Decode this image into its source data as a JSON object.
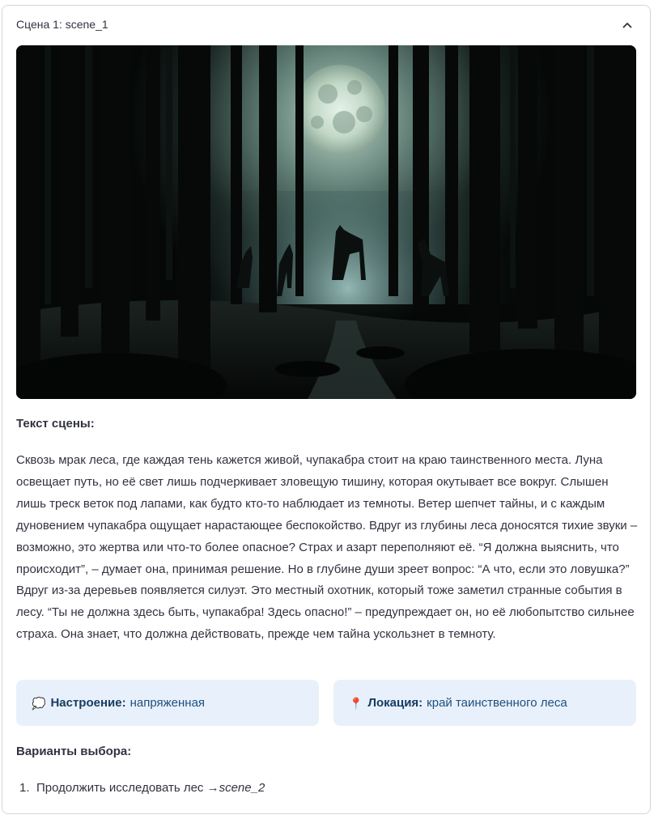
{
  "expander": {
    "title": "Сцена 1: scene_1",
    "chevron_icon": "chevron-up-icon"
  },
  "scene": {
    "image_alt": "Ночной лес под полной луной с силуэтами чупакабр",
    "text_label": "Текст сцены:",
    "text": "Сквозь мрак леса, где каждая тень кажется живой, чупакабра стоит на краю таинственного места. Луна освещает путь, но её свет лишь подчеркивает зловещую тишину, которая окутывает все вокруг. Слышен лишь треск веток под лапами, как будто кто-то наблюдает из темноты. Ветер шепчет тайны, и с каждым дуновением чупакабра ощущает нарастающее беспокойство. Вдруг из глубины леса доносятся тихие звуки – возможно, это жертва или что-то более опасное? Страх и азарт переполняют её. “Я должна выяснить, что происходит”, – думает она, принимая решение. Но в глубине души зреет вопрос: “А что, если это ловушка?” Вдруг из-за деревьев появляется силуэт. Это местный охотник, который тоже заметил странные события в лесу. “Ты не должна здесь быть, чупакабра! Здесь опасно!” – предупреждает он, но её любопытство сильнее страха. Она знает, что должна действовать, прежде чем тайна ускользнет в темноту."
  },
  "mood": {
    "icon": "thought-bubble-icon",
    "glyph": "💭",
    "label": "Настроение:",
    "value": "напряженная"
  },
  "location": {
    "icon": "pushpin-icon",
    "glyph": "📍",
    "label": "Локация:",
    "value": "край таинственного леса"
  },
  "choices": {
    "label": "Варианты выбора:",
    "items": [
      {
        "num": "1.",
        "text": "Продолжить исследовать лес → ",
        "target": "scene_2"
      }
    ]
  },
  "colors": {
    "info_bg": "#e8f1fb",
    "info_text": "#1f4f7e",
    "border": "#d6d6d9"
  }
}
